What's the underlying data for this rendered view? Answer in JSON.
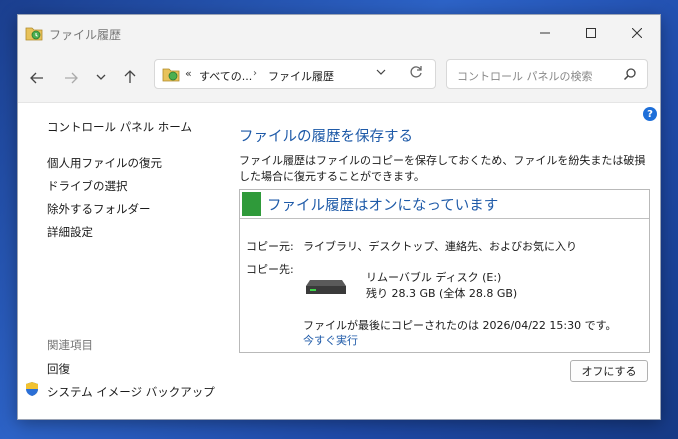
{
  "window": {
    "title": "ファイル履歴"
  },
  "nav": {
    "address_chevron": "«",
    "address_segment_1": "すべての...",
    "address_separator": "›",
    "address_segment_2": "ファイル履歴",
    "search_placeholder": "コントロール パネルの検索"
  },
  "help": {
    "label": "?"
  },
  "sidebar": {
    "home": "コントロール パネル ホーム",
    "items": [
      {
        "label": "個人用ファイルの復元"
      },
      {
        "label": "ドライブの選択"
      },
      {
        "label": "除外するフォルダー"
      },
      {
        "label": "詳細設定"
      }
    ],
    "related_header": "関連項目",
    "related": [
      {
        "label": "回復"
      },
      {
        "label": "システム イメージ バックアップ"
      }
    ]
  },
  "main": {
    "title": "ファイルの履歴を保存する",
    "description": "ファイル履歴はファイルのコピーを保存しておくため、ファイルを紛失または破損した場合に復元することができます。",
    "status": "ファイル履歴はオンになっています",
    "copy_from_label": "コピー元:",
    "copy_from_value": "ライブラリ、デスクトップ、連絡先、およびお気に入り",
    "copy_to_label": "コピー先:",
    "drive_name": "リムーバブル ディスク (E:)",
    "drive_space": "残り 28.3 GB (全体 28.8 GB)",
    "last_copy": "ファイルが最後にコピーされたのは 2026/04/22 15:30 です。",
    "run_now": "今すぐ実行",
    "off_button": "オフにする"
  },
  "colors": {
    "accent_blue": "#1e5aa8",
    "status_green": "#2f9a3a"
  },
  "icons": [
    "file-history-icon",
    "back-arrow-icon",
    "forward-arrow-icon",
    "chevron-down-icon",
    "up-arrow-icon",
    "refresh-icon",
    "search-icon",
    "help-icon",
    "shield-icon",
    "drive-icon"
  ]
}
